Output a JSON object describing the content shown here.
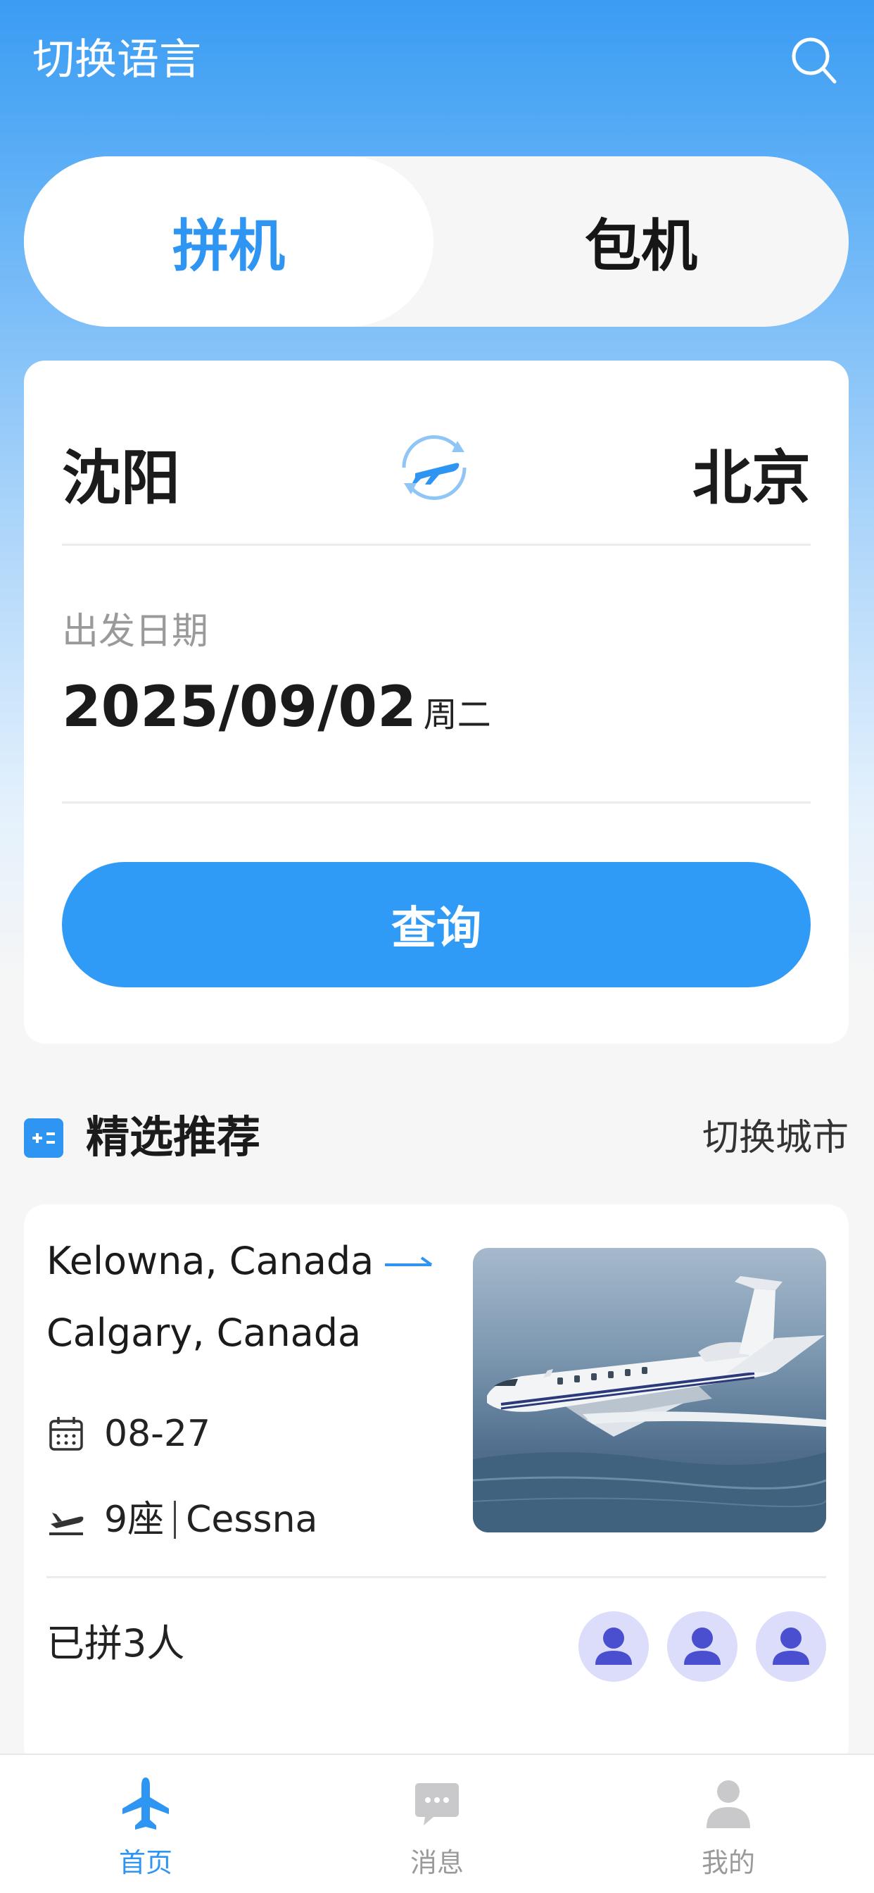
{
  "header": {
    "language_switch": "切换语言",
    "search_icon": "search-icon"
  },
  "segments": {
    "shared": "拼机",
    "charter": "包机",
    "selected": "拼机"
  },
  "search_card": {
    "from_city": "沈阳",
    "to_city": "北京",
    "date_label": "出发日期",
    "date_value": "2025/09/02",
    "weekday": "周二",
    "query_button": "查询"
  },
  "recommend": {
    "title": "精选推荐",
    "switch_city": "切换城市"
  },
  "flight": {
    "origin": "Kelowna, Canada",
    "destination": "Calgary, Canada",
    "date": "08-27",
    "seats": "9座",
    "aircraft": "Cessna",
    "joined": "已拼3人"
  },
  "tabbar": {
    "home": "首页",
    "messages": "消息",
    "mine": "我的"
  },
  "colors": {
    "accent": "#2f95f2",
    "button": "#2f9bf7",
    "avatar_bg": "#dcdcfb",
    "avatar_fg": "#4a4fd0"
  }
}
